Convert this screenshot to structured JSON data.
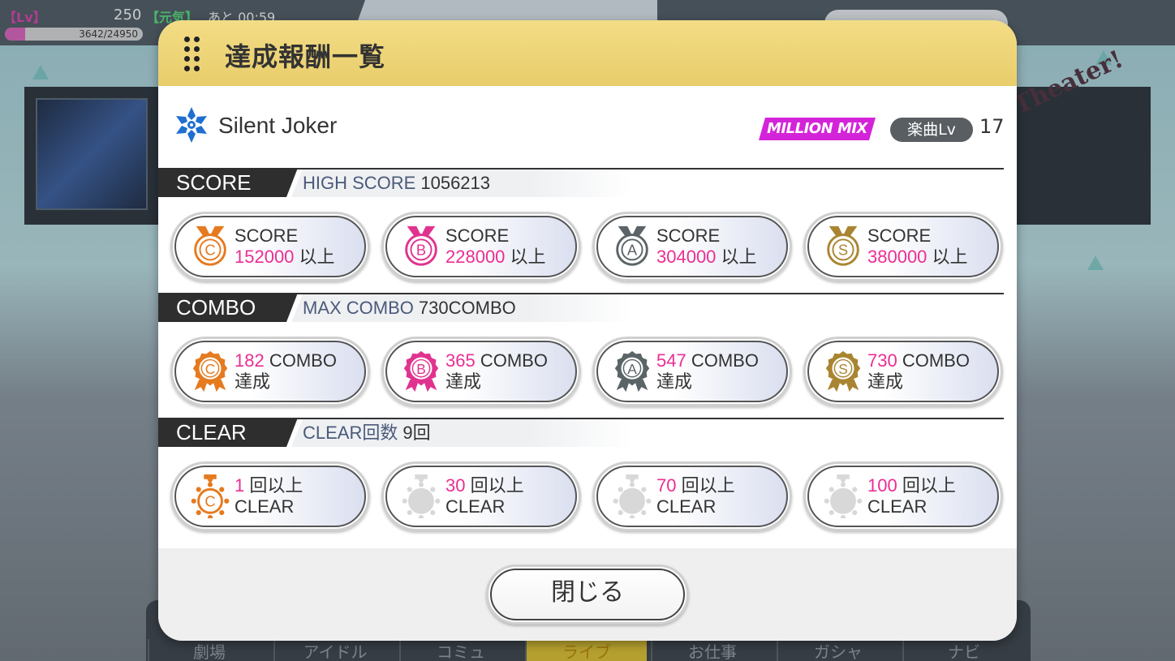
{
  "status_bar": {
    "lv_label": "【Lv】",
    "lv_value": "250",
    "stamina_label": "【元気】",
    "timer": "あと 00:59",
    "exp_text": "3642/24950",
    "exp_progress": 0.146
  },
  "nav_tabs": [
    {
      "label": "劇場"
    },
    {
      "label": "アイドル"
    },
    {
      "label": "コミュ"
    },
    {
      "label": "ライブ",
      "active": true
    },
    {
      "label": "お仕事"
    },
    {
      "label": "ガシャ"
    },
    {
      "label": "ナビ"
    }
  ],
  "banner": {
    "text": "Brand New Theater!"
  },
  "modal": {
    "title": "達成報酬一覧",
    "song": {
      "title": "Silent Joker",
      "icon": "snowflake-icon",
      "difficulty_badge": "MILLION MIX",
      "level_label": "楽曲Lv",
      "level_value": "17"
    },
    "sections": {
      "score": {
        "label": "SCORE",
        "stat_key": "HIGH SCORE",
        "stat_value": "1056213",
        "cards": [
          {
            "rank": "C",
            "icon": "medal-c-icon",
            "l1": "SCORE",
            "value": "152000",
            "suffix": "以上",
            "color": "#e57a1f"
          },
          {
            "rank": "B",
            "icon": "medal-b-icon",
            "l1": "SCORE",
            "value": "228000",
            "suffix": "以上",
            "color": "#e0338f"
          },
          {
            "rank": "A",
            "icon": "medal-a-icon",
            "l1": "SCORE",
            "value": "304000",
            "suffix": "以上",
            "color": "#5b6466"
          },
          {
            "rank": "S",
            "icon": "medal-s-icon",
            "l1": "SCORE",
            "value": "380000",
            "suffix": "以上",
            "color": "#a98531"
          }
        ]
      },
      "combo": {
        "label": "COMBO",
        "stat_key": "MAX COMBO",
        "stat_value": "730COMBO",
        "cards": [
          {
            "rank": "C",
            "icon": "rosette-c-icon",
            "value": "182",
            "suffix": "COMBO",
            "l2": "達成",
            "color": "#e57a1f"
          },
          {
            "rank": "B",
            "icon": "rosette-b-icon",
            "value": "365",
            "suffix": "COMBO",
            "l2": "達成",
            "color": "#e0338f"
          },
          {
            "rank": "A",
            "icon": "rosette-a-icon",
            "value": "547",
            "suffix": "COMBO",
            "l2": "達成",
            "color": "#5b6466"
          },
          {
            "rank": "S",
            "icon": "rosette-s-icon",
            "value": "730",
            "suffix": "COMBO",
            "l2": "達成",
            "color": "#a98531"
          }
        ]
      },
      "clear": {
        "label": "CLEAR",
        "stat_key": "CLEAR回数",
        "stat_value": "9回",
        "cards": [
          {
            "rank": "C",
            "icon": "sun-medal-c-icon",
            "value": "1",
            "suffix": "回以上",
            "l2": "CLEAR",
            "color": "#e57a1f",
            "achieved": true
          },
          {
            "rank": "",
            "icon": "sun-medal-locked-icon",
            "value": "30",
            "suffix": "回以上",
            "l2": "CLEAR",
            "color": "#d8d8d8",
            "achieved": false
          },
          {
            "rank": "",
            "icon": "sun-medal-locked-icon",
            "value": "70",
            "suffix": "回以上",
            "l2": "CLEAR",
            "color": "#d8d8d8",
            "achieved": false
          },
          {
            "rank": "",
            "icon": "sun-medal-locked-icon",
            "value": "100",
            "suffix": "回以上",
            "l2": "CLEAR",
            "color": "#d8d8d8",
            "achieved": false
          }
        ]
      }
    },
    "close_label": "閉じる"
  }
}
